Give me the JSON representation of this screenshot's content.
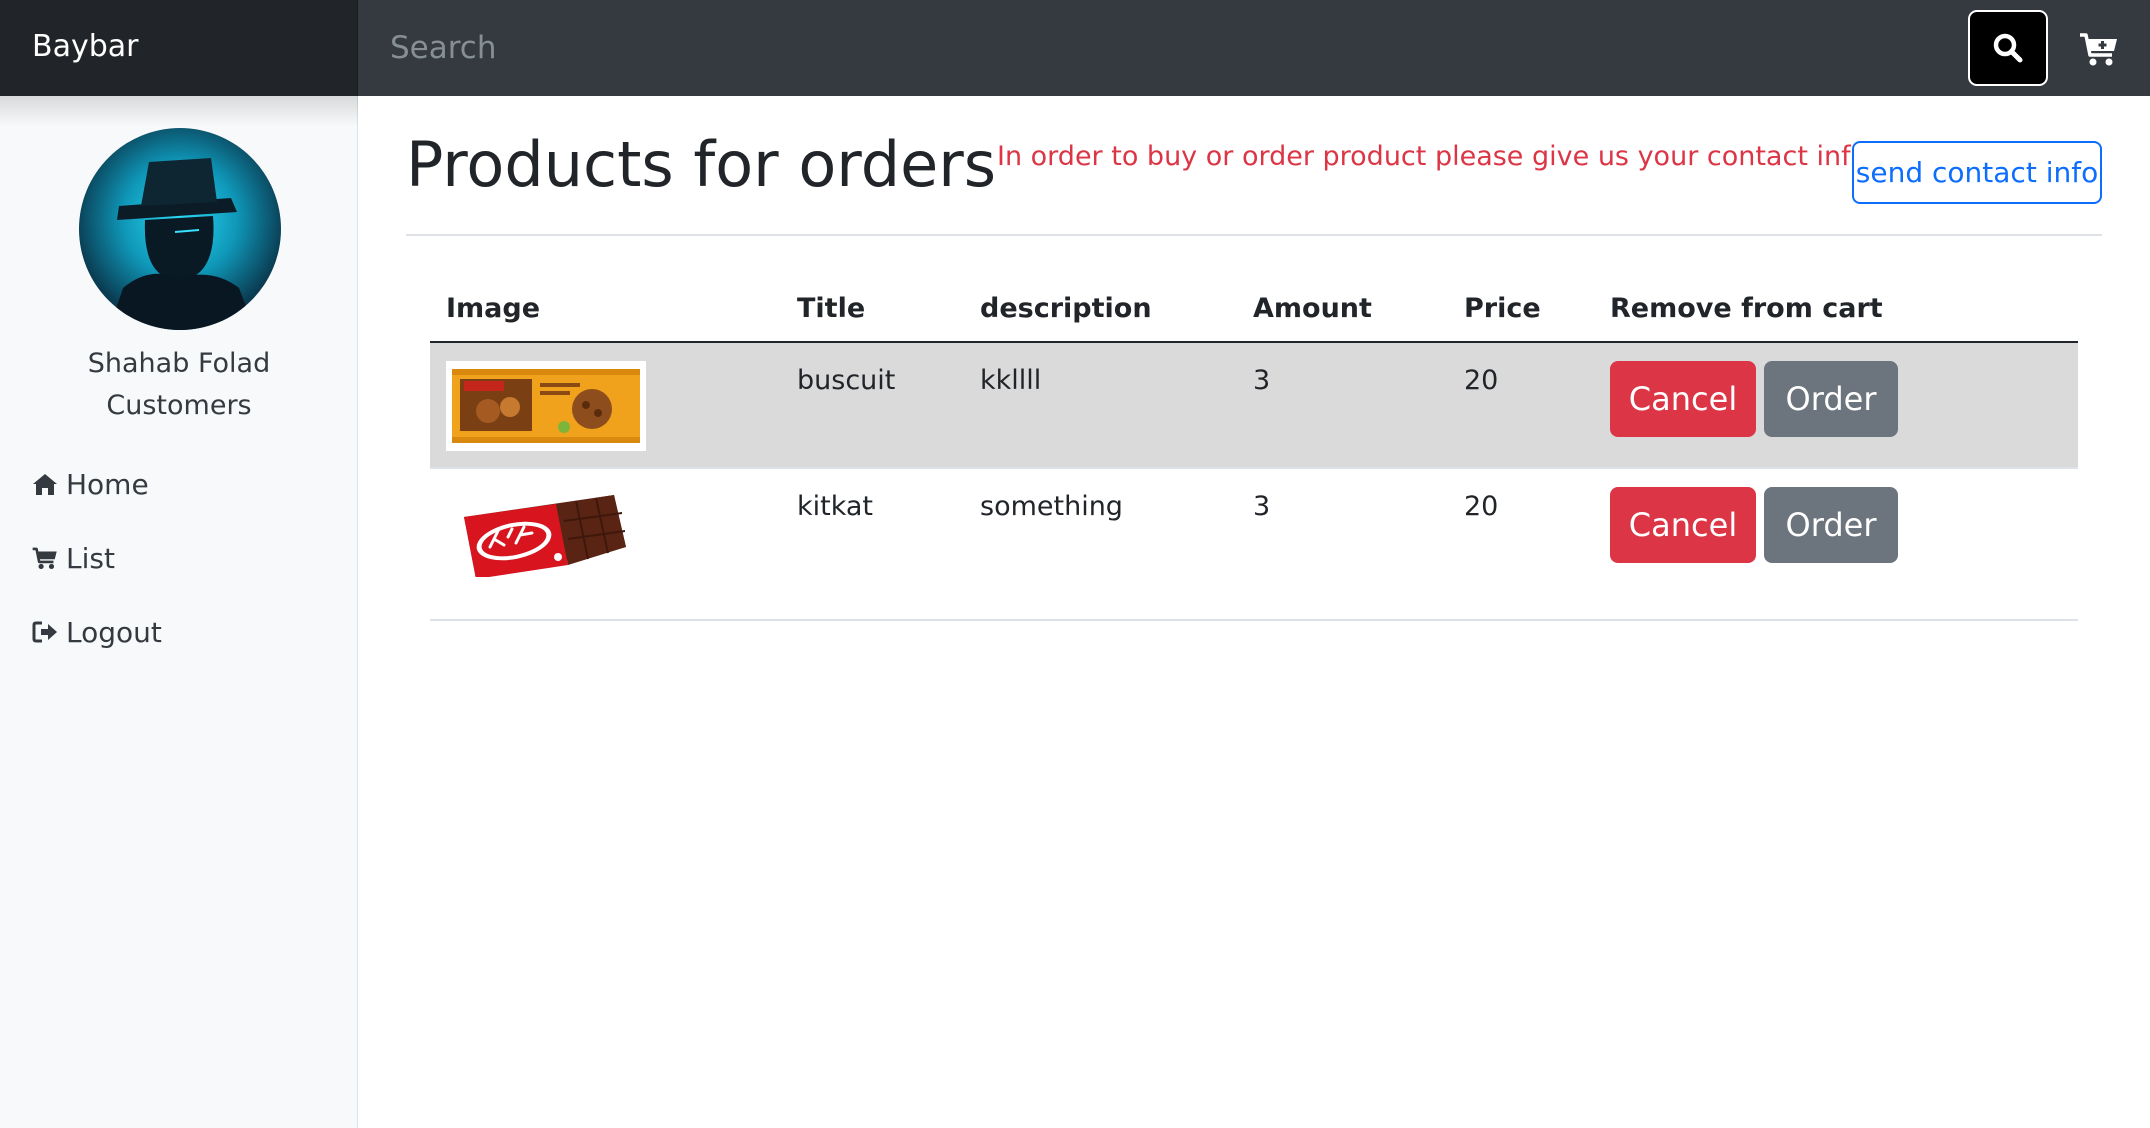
{
  "app": {
    "brand": "Baybar",
    "search": {
      "placeholder": "Search",
      "value": ""
    }
  },
  "sidebar": {
    "user": {
      "name": "Shahab Folad",
      "role": "Customers"
    },
    "items": [
      {
        "label": "Home",
        "icon": "home-icon"
      },
      {
        "label": "List",
        "icon": "cart-icon"
      },
      {
        "label": "Logout",
        "icon": "sign-out-icon"
      }
    ]
  },
  "main": {
    "title": "Products for orders",
    "notice": "In order to buy or order product please give us your contact info",
    "contact_button": "send contact info",
    "table": {
      "headers": [
        "Image",
        "Title",
        "description",
        "Amount",
        "Price",
        "Remove from cart"
      ],
      "rows": [
        {
          "image": "biscuit package",
          "title": "buscuit",
          "description": "kkllll",
          "amount": "3",
          "price": "20",
          "cancel": "Cancel",
          "order": "Order"
        },
        {
          "image": "kitkat chocolate bar",
          "title": "kitkat",
          "description": "something",
          "amount": "3",
          "price": "20",
          "cancel": "Cancel",
          "order": "Order"
        }
      ]
    }
  },
  "colors": {
    "navbar": "#343a40",
    "brand_bg": "#212529",
    "danger": "#dc3545",
    "secondary": "#6c757d",
    "primary": "#0d6efd",
    "row_highlight": "#dadada"
  }
}
